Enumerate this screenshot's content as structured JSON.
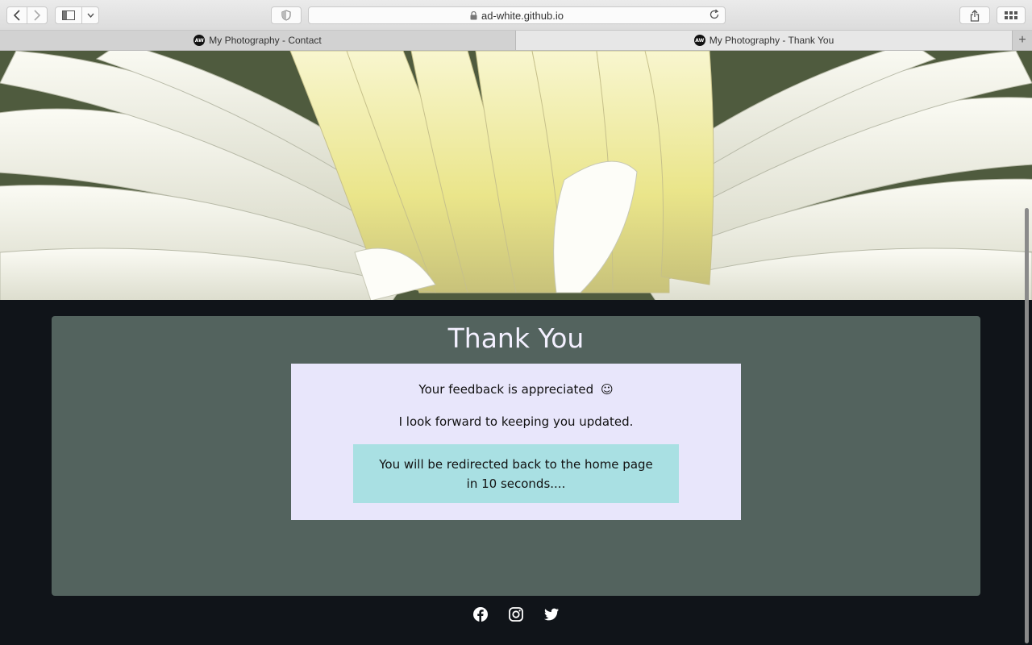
{
  "browser": {
    "url": "ad-white.github.io",
    "tabs": [
      {
        "title": "My Photography - Contact",
        "favicon_text": "AW"
      },
      {
        "title": "My Photography - Thank You",
        "favicon_text": "AW"
      }
    ],
    "new_tab_label": "+",
    "icons": [
      "back-icon",
      "forward-icon",
      "sidebar-icon",
      "chevron-down-icon",
      "shield-icon",
      "lock-icon",
      "reload-icon",
      "share-icon",
      "tab-overview-icon"
    ]
  },
  "hero": {
    "image": "white dahlia flower close-up"
  },
  "main": {
    "title": "Thank You",
    "feedback_text": "Your feedback is appreciated",
    "feedback_emoji": "☺",
    "update_text": "I look forward to keeping you updated.",
    "redirect_text": "You will be redirected back to the home page in 10 seconds...."
  },
  "footer": {
    "social_icons": [
      "facebook-icon",
      "instagram-icon",
      "twitter-icon"
    ]
  },
  "colors": {
    "page_bg": "#101419",
    "card_bg": "#53635e",
    "message_bg": "#e8e6fb",
    "redirect_bg": "#a9e0e3",
    "title_color": "#f3f0ff"
  }
}
